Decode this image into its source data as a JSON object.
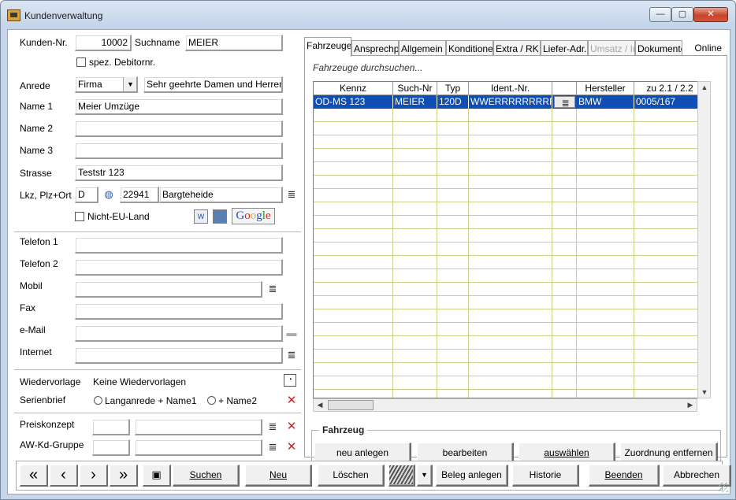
{
  "window": {
    "title": "Kundenverwaltung",
    "min_glyph": "—",
    "max_glyph": "▢",
    "close_glyph": "✕"
  },
  "left": {
    "kunden_nr_label": "Kunden-Nr.",
    "kunden_nr_value": "10002",
    "suchname_label": "Suchname",
    "suchname_value": "MEIER",
    "spez_debitor_label": "spez. Debitornr.",
    "anrede_label": "Anrede",
    "anrede_value": "Firma",
    "briefanrede_value": "Sehr geehrte Damen und Herren",
    "name1_label": "Name 1",
    "name1_value": "Meier Umzüge",
    "name2_label": "Name 2",
    "name2_value": "",
    "name3_label": "Name 3",
    "name3_value": "",
    "strasse_label": "Strasse",
    "strasse_value": "Teststr 123",
    "plz_ort_label": "Lkz, Plz+Ort",
    "lkz_value": "D",
    "plz_value": "22941",
    "ort_value": "Bargteheide",
    "nicht_eu_label": "Nicht-EU-Land",
    "google_text": [
      "G",
      "o",
      "o",
      "g",
      "l",
      "e"
    ],
    "telefon1_label": "Telefon 1",
    "telefon2_label": "Telefon 2",
    "mobil_label": "Mobil",
    "fax_label": "Fax",
    "email_label": "e-Mail",
    "internet_label": "Internet",
    "wiedervorlage_label": "Wiedervorlage",
    "wiedervorlage_value": "Keine Wiedervorlagen",
    "serienbrief_label": "Serienbrief",
    "serienbrief_opt1": "Langanrede + Name1",
    "serienbrief_opt2": "+ Name2",
    "preiskonzept_label": "Preiskonzept",
    "awkd_label": "AW-Kd-Gruppe",
    "list_glyph": "≣",
    "x_glyph": "✕"
  },
  "tabs": [
    "Fahrzeuge",
    "Ansprechpartner",
    "Allgemein",
    "Konditionen",
    "Extra / RK",
    "Liefer-Adr.",
    "Umsatz / Info",
    "Dokumente",
    "Online"
  ],
  "vehicles": {
    "search_placeholder": "Fahrzeuge durchsuchen...",
    "columns": [
      "Kennz",
      "Such-Nr",
      "Typ",
      "Ident.-Nr.",
      "",
      "Hersteller",
      "zu 2.1 / 2.2"
    ],
    "rows": [
      {
        "kennz": "OD-MS 123",
        "such_nr": "MEIER",
        "typ": "120D",
        "ident": "WWERRRRRRRRRRR",
        "hersteller": "BMW",
        "zu": "0005/167"
      }
    ],
    "group_title": "Fahrzeug",
    "btn_neu": "neu anlegen",
    "btn_bearbeiten": "bearbeiten",
    "btn_auswaehlen": "auswählen",
    "btn_zuordnung": "Zuordnung entfernen"
  },
  "toolbar": {
    "first": "«",
    "prev": "‹",
    "next": "›",
    "last": "»",
    "suchen": "Suchen",
    "neu": "Neu",
    "loeschen": "Löschen",
    "beleg": "Beleg anlegen",
    "historie": "Historie",
    "beenden": "Beenden",
    "abbrechen": "Abbrechen"
  },
  "colors": {
    "selection": "#0f4fb3",
    "grid_line": "#c9d18a"
  }
}
